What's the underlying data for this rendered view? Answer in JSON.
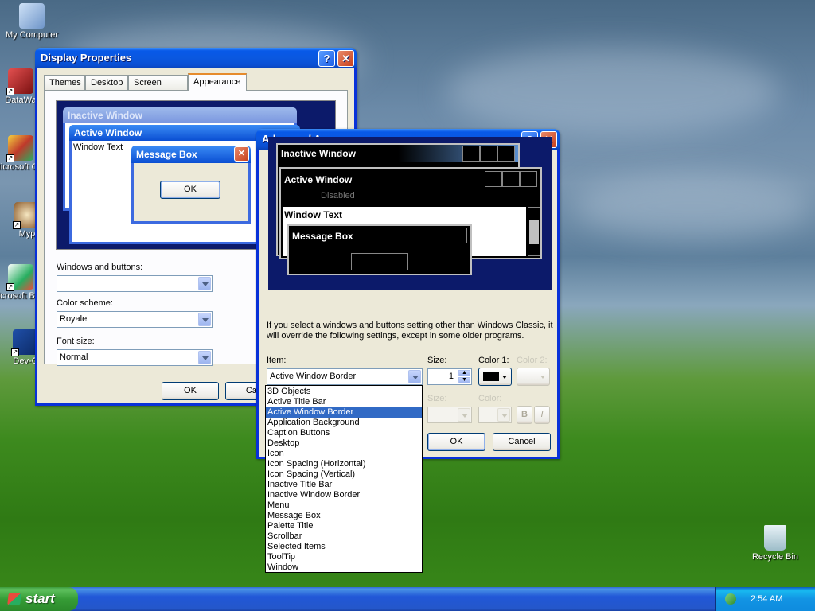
{
  "desktop": {
    "icons": [
      {
        "label": "My Computer"
      },
      {
        "label": "DataWa"
      },
      {
        "label": "Microsoft C++"
      },
      {
        "label": "Myp"
      },
      {
        "label": "Microsoft Basic"
      },
      {
        "label": "Dev-C"
      },
      {
        "label": "Recycle Bin"
      }
    ]
  },
  "display_properties": {
    "title": "Display Properties",
    "help_glyph": "?",
    "close_glyph": "✕",
    "tabs": [
      {
        "label": "Themes"
      },
      {
        "label": "Desktop"
      },
      {
        "label": "Screen Saver"
      },
      {
        "label": "Appearance"
      }
    ],
    "preview": {
      "inactive_title": "Inactive Window",
      "active_title": "Active Window",
      "window_text": "Window Text",
      "message_box_title": "Message Box",
      "message_ok": "OK"
    },
    "windows_buttons_label": "Windows and buttons:",
    "windows_buttons_value": "",
    "color_scheme_label": "Color scheme:",
    "color_scheme_value": "Royale",
    "font_size_label": "Font size:",
    "font_size_value": "Normal",
    "ok_label": "OK",
    "cancel_label": "Can"
  },
  "advanced_appearance": {
    "title": "Advanced Appearance",
    "help_glyph": "?",
    "close_glyph": "✕",
    "preview": {
      "inactive_title": "Inactive Window",
      "active_title": "Active Window",
      "disabled_text": "Disabled",
      "window_text": "Window Text",
      "message_box_title": "Message Box"
    },
    "info_text": "If you select a windows and buttons setting other than Windows Classic, it will override the following settings, except in some older programs.",
    "item_label": "Item:",
    "item_value": "Active Window Border",
    "size_label": "Size:",
    "size_value": "1",
    "color1_label": "Color 1:",
    "color2_label": "Color 2:",
    "font_size_label": "Size:",
    "font_color_label": "Color:",
    "bold_label": "B",
    "italic_label": "I",
    "ok_label": "OK",
    "cancel_label": "Cancel",
    "item_options": [
      "3D Objects",
      "Active Title Bar",
      "Active Window Border",
      "Application Background",
      "Caption Buttons",
      "Desktop",
      "Icon",
      "Icon Spacing (Horizontal)",
      "Icon Spacing (Vertical)",
      "Inactive Title Bar",
      "Inactive Window Border",
      "Menu",
      "Message Box",
      "Palette Title",
      "Scrollbar",
      "Selected Items",
      "ToolTip",
      "Window"
    ],
    "selected_index": 2
  },
  "taskbar": {
    "start_label": "start",
    "clock": "2:54 AM"
  },
  "colors": {
    "titlebar_blue": "#0a58e0",
    "selection": "#316ac5",
    "color1_swatch": "#000000"
  }
}
